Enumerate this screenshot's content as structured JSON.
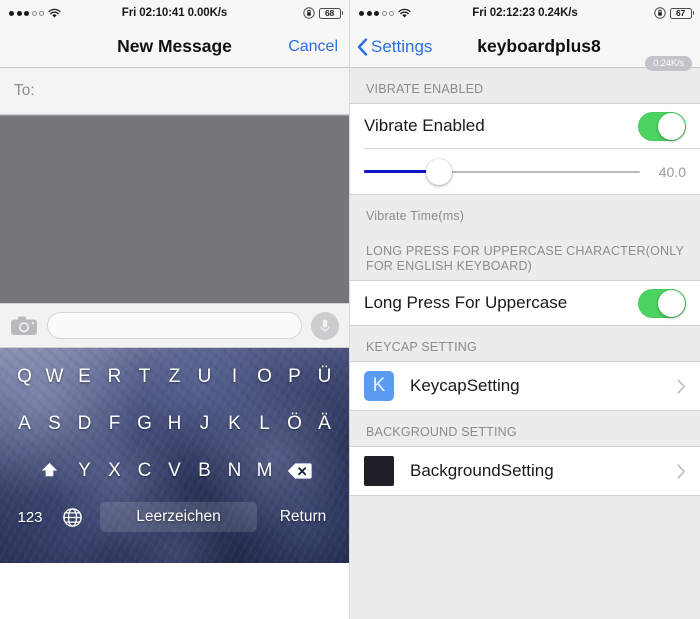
{
  "left": {
    "statusbar": {
      "signal_dots_filled": 3,
      "signal_dots_total": 5,
      "wifi_icon": "wifi-icon",
      "center_text": "Fri 02:10:41 0.00K/s",
      "lock_icon": "rotation-lock-icon",
      "battery_level": "68"
    },
    "navbar": {
      "title": "New Message",
      "cancel_label": "Cancel"
    },
    "compose": {
      "to_label": "To:",
      "camera_icon": "camera-icon",
      "message_input_placeholder": "",
      "message_input_value": "",
      "mic_icon": "microphone-icon"
    },
    "keyboard": {
      "row1": [
        "Q",
        "W",
        "E",
        "R",
        "T",
        "Z",
        "U",
        "I",
        "O",
        "P",
        "Ü"
      ],
      "row2": [
        "A",
        "S",
        "D",
        "F",
        "G",
        "H",
        "J",
        "K",
        "L",
        "Ö",
        "Ä"
      ],
      "row3_letters": [
        "Y",
        "X",
        "C",
        "V",
        "B",
        "N",
        "M"
      ],
      "shift_icon": "shift-icon",
      "delete_icon": "delete-backspace-icon",
      "numeric_label": "123",
      "globe_icon": "globe-icon",
      "space_label": "Leerzeichen",
      "return_label": "Return"
    }
  },
  "right": {
    "statusbar": {
      "signal_dots_filled": 3,
      "signal_dots_total": 5,
      "wifi_icon": "wifi-icon",
      "center_text": "Fri 02:12:23 0.24K/s",
      "lock_icon": "rotation-lock-icon",
      "battery_level": "67"
    },
    "navbar": {
      "back_label": "Settings",
      "back_icon": "chevron-left-icon",
      "title": "keyboardplus8",
      "speed_badge": "0.24K/s"
    },
    "sections": [
      {
        "header": "VIBRATE ENABLED",
        "rows": [
          {
            "type": "toggle",
            "label": "Vibrate Enabled",
            "value": "on"
          },
          {
            "type": "slider",
            "value": "40.0",
            "percent": 27
          }
        ],
        "footer": "Vibrate Time(ms)"
      },
      {
        "header": "LONG PRESS FOR UPPERCASE CHARACTER(ONLY FOR ENGLISH KEYBOARD)",
        "rows": [
          {
            "type": "toggle",
            "label": "Long Press For Uppercase",
            "value": "on"
          }
        ],
        "footer": ""
      },
      {
        "header": "KEYCAP SETTING",
        "rows": [
          {
            "type": "link",
            "label": "KeycapSetting",
            "icon_text": "K",
            "icon_kind": "keycap"
          }
        ],
        "footer": ""
      },
      {
        "header": "BACKGROUND SETTING",
        "rows": [
          {
            "type": "link",
            "label": "BackgroundSetting",
            "icon_text": "",
            "icon_kind": "bg"
          }
        ],
        "footer": ""
      }
    ],
    "colors": {
      "toggle_on": "#4cd462",
      "accent_blue": "#2a6ee0",
      "slider_fill": "#1414c8",
      "keycap_icon_bg": "#5b9bf0",
      "background_icon_bg": "#1d2027"
    }
  }
}
